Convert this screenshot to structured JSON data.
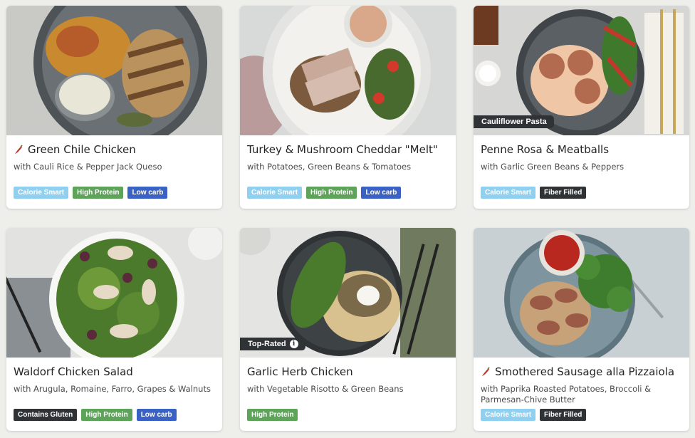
{
  "colors": {
    "page_background": "#eeeeea",
    "tag_calorie_smart": "#8fd0f0",
    "tag_high_protein": "#5ea35a",
    "tag_low_carb": "#3a62c4",
    "tag_dark": "#2f3336"
  },
  "cards": [
    {
      "title": "Green Chile Chicken",
      "subtitle": "with Cauli Rice & Pepper Jack Queso",
      "spicy_icon": "chili-pepper-icon",
      "tags": [
        "Calorie Smart",
        "High Protein",
        "Low carb"
      ]
    },
    {
      "title": "Turkey & Mushroom Cheddar \"Melt\"",
      "subtitle": "with Potatoes, Green Beans & Tomatoes",
      "tags": [
        "Calorie Smart",
        "High Protein",
        "Low carb"
      ]
    },
    {
      "title": "Penne Rosa & Meatballs",
      "subtitle": "with Garlic Green Beans & Peppers",
      "photo_badge": "Cauliflower Pasta",
      "tags": [
        "Calorie Smart",
        "Fiber Filled"
      ]
    },
    {
      "title": "Waldorf Chicken Salad",
      "subtitle": "with Arugula, Romaine, Farro, Grapes & Walnuts",
      "tags": [
        "Contains Gluten",
        "High Protein",
        "Low carb"
      ]
    },
    {
      "title": "Garlic Herb Chicken",
      "subtitle": "with Vegetable Risotto & Green Beans",
      "photo_badge": "Top-Rated",
      "photo_badge_icon": "info-icon",
      "tags": [
        "High Protein"
      ]
    },
    {
      "title": "Smothered Sausage alla Pizzaiola",
      "subtitle": "with Paprika Roasted Potatoes, Broccoli & Parmesan-Chive Butter",
      "spicy_icon": "chili-pepper-icon",
      "tags": [
        "Calorie Smart",
        "Fiber Filled"
      ]
    }
  ]
}
